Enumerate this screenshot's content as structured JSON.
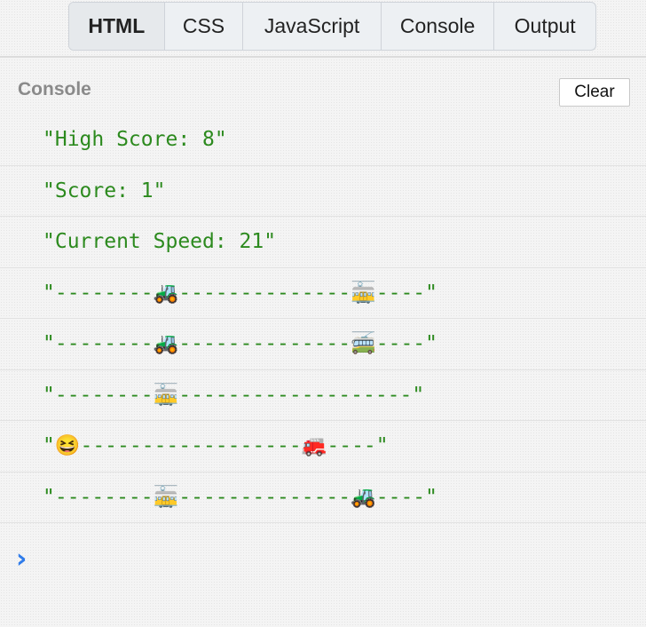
{
  "tabs": [
    {
      "label": "HTML",
      "active": true
    },
    {
      "label": "CSS",
      "active": false
    },
    {
      "label": "JavaScript",
      "active": false
    },
    {
      "label": "Console",
      "active": false
    },
    {
      "label": "Output",
      "active": false
    }
  ],
  "console": {
    "title": "Console",
    "clear_label": "Clear",
    "prompt_icon": "chevron-right-icon",
    "lines": [
      "\"High Score: 8\"",
      "\"Score: 1\"",
      "\"Current Speed: 21\"",
      "\"--------🚜--------------🚋----\"",
      "\"--------🚜--------------🚎----\"",
      "\"--------🚋-------------------\"",
      "\"😆------------------🚒----\"",
      "\"--------🚋--------------🚜----\""
    ]
  },
  "colors": {
    "log_text": "#2c8a1e",
    "prompt": "#2f7bea",
    "title": "#8a8a8a"
  }
}
